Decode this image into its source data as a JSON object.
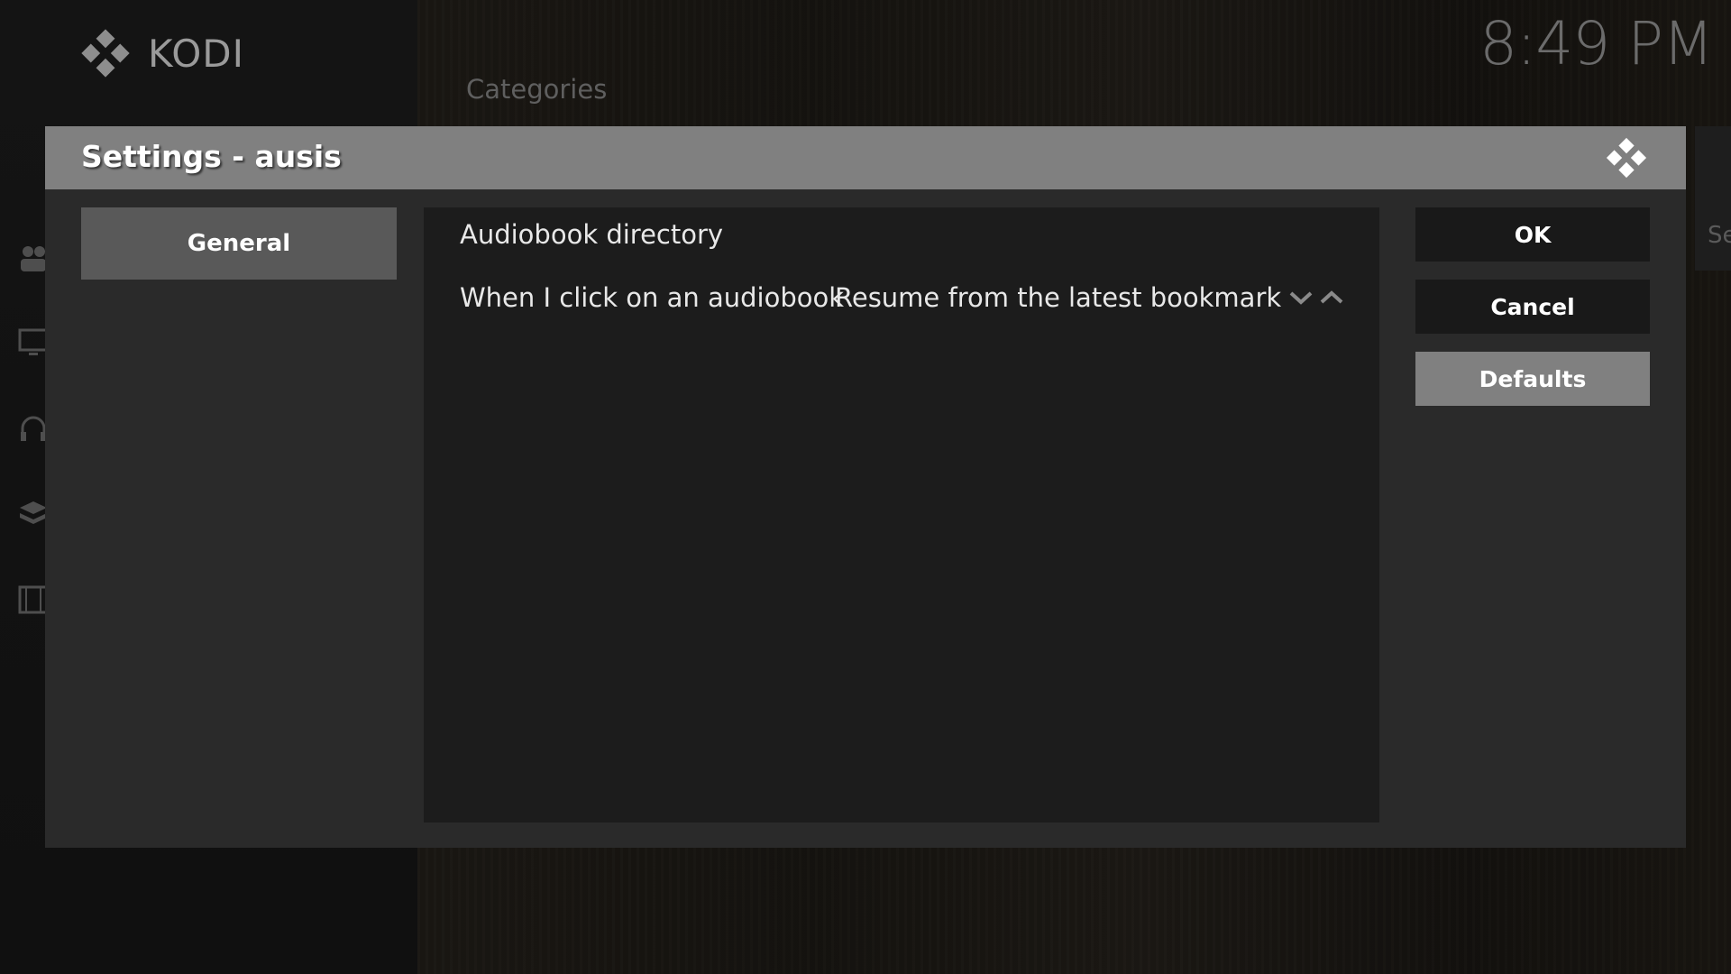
{
  "app": {
    "brand": "KODI",
    "clock": "8:49 PM",
    "home_section_label": "Categories",
    "right_peek_text": "Se"
  },
  "dialog": {
    "title": "Settings - ausis",
    "categories": [
      {
        "label": "General",
        "selected": true
      }
    ],
    "settings": [
      {
        "label": "Audiobook directory",
        "value": ""
      },
      {
        "label": "When I click on an audiobook",
        "value": "Resume from the latest bookmark"
      }
    ],
    "buttons": {
      "ok": "OK",
      "cancel": "Cancel",
      "defaults": "Defaults"
    }
  },
  "colors": {
    "header_bg": "#808080",
    "dialog_bg": "#2a2a2a",
    "panel_bg": "#1c1c1c",
    "selected_category": "#595959",
    "button_bg": "#191919",
    "focused_button": "#808080"
  },
  "icons": [
    "kodi-logo-icon",
    "spin-down-icon",
    "spin-up-icon",
    "users-icon",
    "tv-icon",
    "headphones-icon",
    "addons-icon",
    "movies-icon"
  ]
}
